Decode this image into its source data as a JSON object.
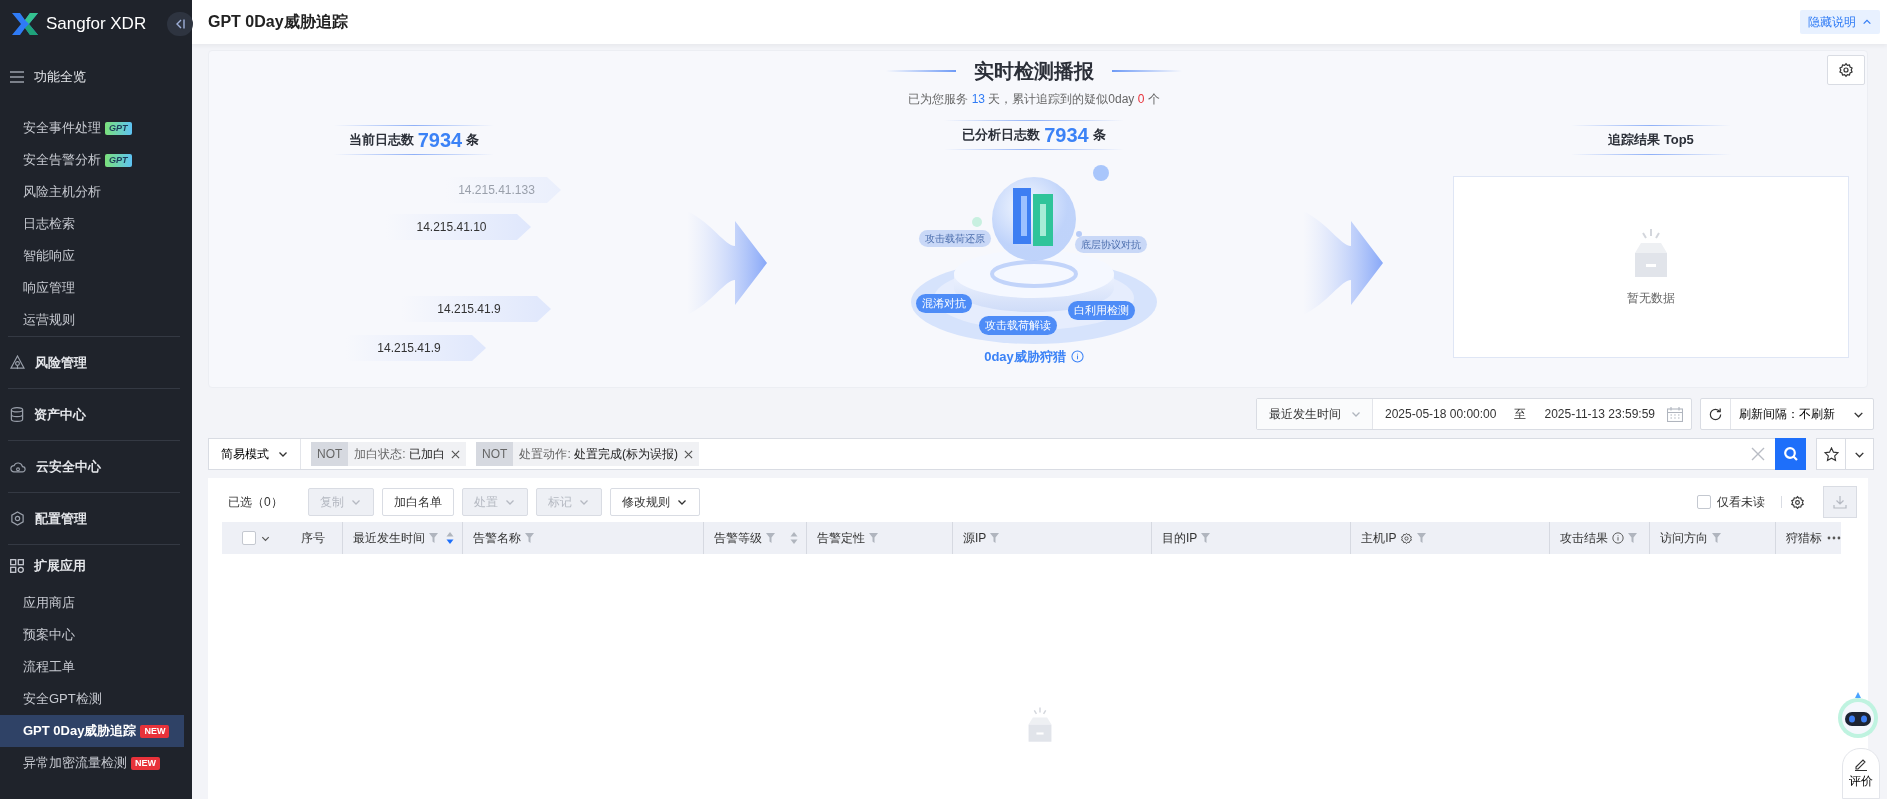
{
  "sidebar": {
    "brand": "Sangfor XDR",
    "groups": [
      {
        "label": "功能全览",
        "items": [
          {
            "label": "安全事件处理",
            "badge": {
              "text": "GPT",
              "kind": "gpt"
            },
            "selected": false
          },
          {
            "label": "安全告警分析",
            "badge": {
              "text": "GPT",
              "kind": "gpt"
            },
            "selected": false
          },
          {
            "label": "风险主机分析",
            "selected": false
          },
          {
            "label": "日志检索",
            "selected": false
          },
          {
            "label": "智能响应",
            "selected": false
          },
          {
            "label": "响应管理",
            "selected": false
          },
          {
            "label": "运营规则",
            "selected": false
          }
        ]
      },
      {
        "label": "风险管理"
      },
      {
        "label": "资产中心"
      },
      {
        "label": "云安全中心"
      },
      {
        "label": "配置管理"
      },
      {
        "label": "扩展应用",
        "items": [
          {
            "label": "应用商店",
            "selected": false
          },
          {
            "label": "预案中心",
            "selected": false
          },
          {
            "label": "流程工单",
            "selected": false
          },
          {
            "label": "安全GPT检测",
            "selected": false
          },
          {
            "label": "GPT 0Day威胁追踪",
            "badge": {
              "text": "NEW",
              "kind": "new"
            },
            "selected": true
          },
          {
            "label": "异常加密流量检测",
            "badge": {
              "text": "NEW",
              "kind": "new"
            },
            "selected": false
          }
        ]
      }
    ]
  },
  "header": {
    "title": "GPT 0Day威胁追踪",
    "toggle": "隐藏说明"
  },
  "broadcast": {
    "title": "实时检测播报",
    "summary": {
      "before": "已为您服务",
      "days": "13",
      "middle": "天，累计追踪到的疑似0day",
      "count": "0",
      "after": "个"
    },
    "current": {
      "label": "当前日志数",
      "count": "7934",
      "unit": "条",
      "ips": [
        {
          "ip": "14.215.41.133",
          "faded": true
        },
        {
          "ip": "14.215.41.10",
          "faded": false
        },
        {
          "ip": "14.215.41.9",
          "faded": false
        },
        {
          "ip": "14.215.41.9",
          "faded": false
        }
      ]
    },
    "analyzed": {
      "label": "已分析日志数",
      "count": "7934",
      "unit": "条",
      "tags": [
        {
          "text": "攻击载荷还原",
          "faint": true
        },
        {
          "text": "底层协议对抗",
          "faint": true
        },
        {
          "text": "混淆对抗",
          "faint": false
        },
        {
          "text": "攻击载荷解读",
          "faint": false
        },
        {
          "text": "白利用检测",
          "faint": false
        }
      ],
      "caption": "0day威胁狩猎"
    },
    "top5": {
      "title": "追踪结果 Top5",
      "empty": "暂无数据"
    }
  },
  "time_filter": {
    "field": "最近发生时间",
    "start": "2025-05-18 00:00:00",
    "separator": "至",
    "end": "2025-11-13 23:59:59",
    "refresh": "刷新间隔：不刷新"
  },
  "filter": {
    "mode": "简易模式",
    "chips": [
      {
        "op": "NOT",
        "field": "加白状态:",
        "value": "已加白"
      },
      {
        "op": "NOT",
        "field": "处置动作:",
        "value": "处置完成(标为误报)"
      }
    ]
  },
  "toolbar": {
    "selected": "已选（0）",
    "buttons": [
      {
        "label": "复制",
        "disabled": true,
        "dropdown": true
      },
      {
        "label": "加白名单",
        "disabled": false,
        "dropdown": false
      },
      {
        "label": "处置",
        "disabled": true,
        "dropdown": true
      },
      {
        "label": "标记",
        "disabled": true,
        "dropdown": true
      },
      {
        "label": "修改规则",
        "disabled": false,
        "dropdown": true
      }
    ],
    "unread": {
      "label": "仅看未读",
      "checked": false
    }
  },
  "table": {
    "select_all": false,
    "columns": [
      {
        "label": "序号",
        "filter": false
      },
      {
        "label": "最近发生时间",
        "filter": true,
        "sortable": true,
        "sorted_desc": true
      },
      {
        "label": "告警名称",
        "filter": true
      },
      {
        "label": "告警等级",
        "filter": true,
        "sortable": true,
        "sorted_desc": false
      },
      {
        "label": "告警定性",
        "filter": true
      },
      {
        "label": "源IP",
        "filter": true
      },
      {
        "label": "目的IP",
        "filter": true
      },
      {
        "label": "主机IP",
        "filter": true
      },
      {
        "label": "攻击结果",
        "filter": true
      },
      {
        "label": "访问方向",
        "filter": true
      },
      {
        "label": "狩猎标",
        "filter": false
      }
    ]
  },
  "feedback": "评价"
}
